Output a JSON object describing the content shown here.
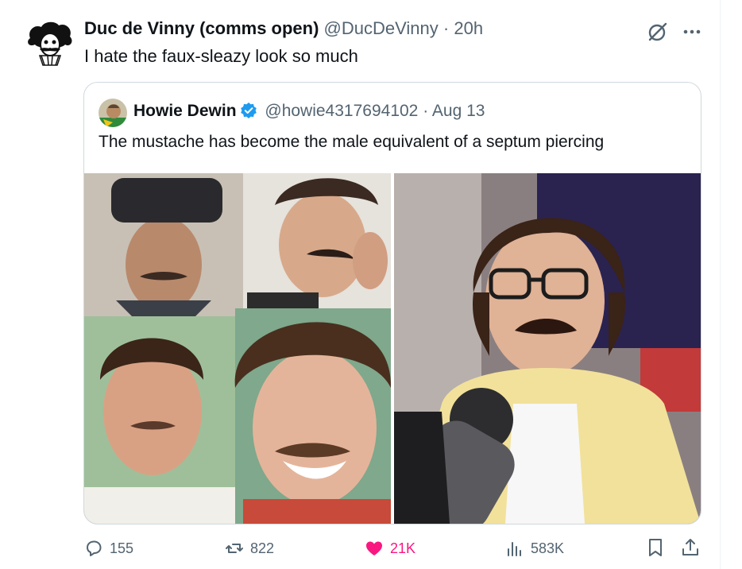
{
  "tweet": {
    "author_name": "Duc de Vinny (comms open)",
    "author_handle": "@DucDeVinny",
    "separator": "·",
    "time": "20h",
    "text": "I hate the faux-sleazy look so much"
  },
  "quoted": {
    "author_name": "Howie Dewin",
    "author_handle": "@howie4317694102",
    "separator": "·",
    "date": "Aug 13",
    "text": "The mustache has become the male equivalent of a septum piercing",
    "verified": true
  },
  "actions": {
    "replies": "155",
    "reposts": "822",
    "likes": "21K",
    "views": "583K",
    "liked": true
  },
  "icons": {
    "grok": "grok-icon",
    "more": "more-icon",
    "reply": "reply-icon",
    "repost": "repost-icon",
    "like": "heart-icon",
    "views": "views-icon",
    "bookmark": "bookmark-icon",
    "share": "share-icon"
  },
  "colors": {
    "like_pink": "#f91880",
    "verified_blue": "#1d9bf0",
    "muted_text": "#536471"
  }
}
